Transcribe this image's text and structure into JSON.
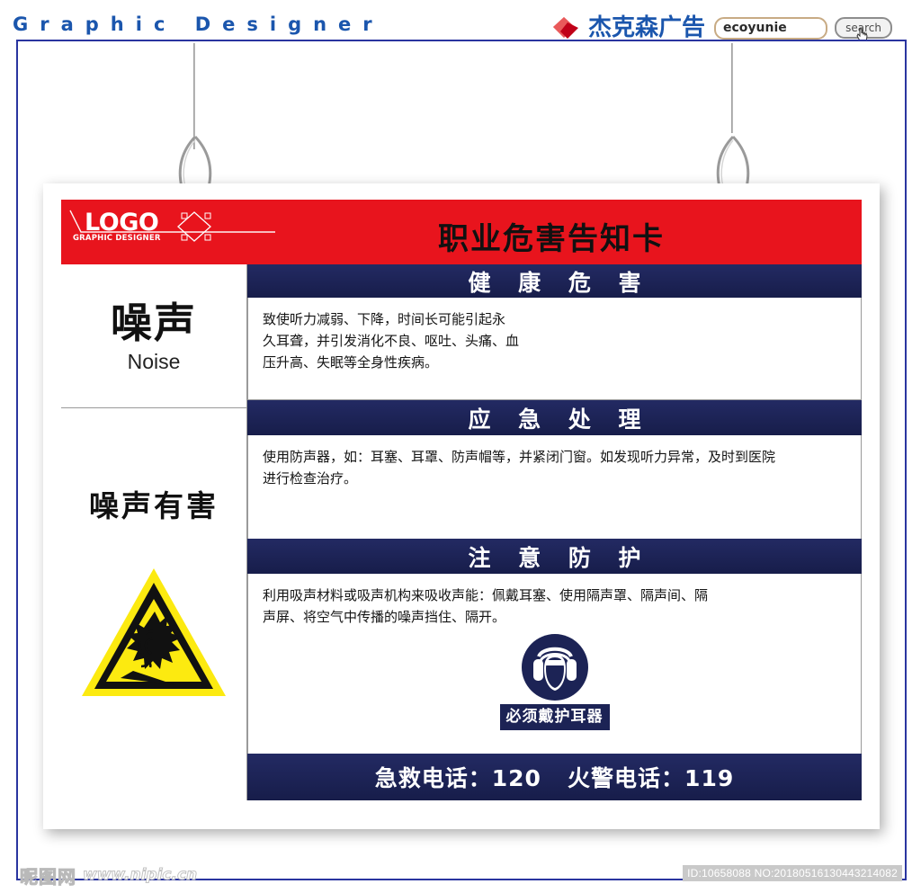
{
  "topbar": {
    "brand_title": "Graphic Designer",
    "cn_brand": "杰克森广告",
    "search_value": "ecoyunie",
    "search_placeholder": "",
    "search_button": "search",
    "diamond_icon": "red-diamond-logo",
    "cursor_icon": "hand-cursor-icon"
  },
  "poster": {
    "logo": {
      "text": "LOGO",
      "subtext": "GRAPHIC DESIGNER"
    },
    "title": "职业危害告知卡",
    "left": {
      "hazard_cn": "噪声",
      "hazard_en": "Noise",
      "slogan": "噪声有害",
      "warning_icon": "noise-hazard-warning-triangle-icon"
    },
    "sections": [
      {
        "band": "健 康 危 害",
        "text": "致使听力减弱、下降，时间长可能引起永\n久耳聋，并引发消化不良、呕吐、头痛、血\n压升高、失眠等全身性疾病。"
      },
      {
        "band": "应 急 处 理",
        "text": "使用防声器，如：耳塞、耳罩、防声帽等，并紧闭门窗。如发现听力异常，及时到医院\n进行检查治疗。"
      },
      {
        "band": "注 意 防 护",
        "text": "利用吸声材料或吸声机构来吸收声能：佩戴耳塞、使用隔声罩、隔声间、隔\n声屏、将空气中传播的噪声挡住、隔开。"
      }
    ],
    "ppe": {
      "icon": "wear-ear-protection-icon",
      "label": "必须戴护耳器"
    },
    "phone_band": "急救电话：120   火警电话：119"
  },
  "watermark": {
    "logo": "昵图网",
    "url": "www.nipic.cn",
    "id_text": "ID:10658088 NO:20180516130443214082"
  },
  "colors": {
    "brand_blue": "#1b56ad",
    "frame_blue": "#2a35a0",
    "poster_red": "#e8141d",
    "band_navy": "#1c2355",
    "warning_yellow": "#fcea10"
  }
}
